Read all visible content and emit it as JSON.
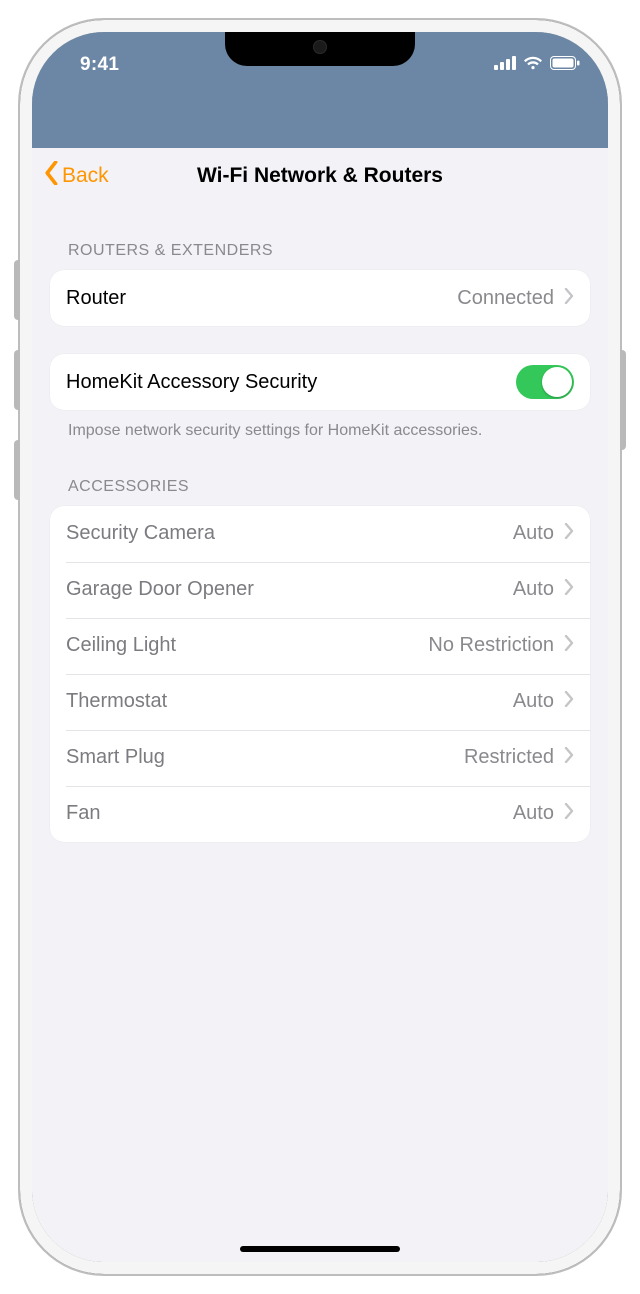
{
  "status": {
    "time": "9:41"
  },
  "nav": {
    "back_label": "Back",
    "title": "Wi-Fi Network & Routers"
  },
  "sections": {
    "routers_header": "ROUTERS & EXTENDERS",
    "router_row": {
      "label": "Router",
      "value": "Connected"
    },
    "security_toggle": {
      "label": "HomeKit Accessory Security",
      "on": true
    },
    "security_note": "Impose network security settings for HomeKit accessories.",
    "accessories_header": "ACCESSORIES",
    "accessories": [
      {
        "label": "Security Camera",
        "value": "Auto"
      },
      {
        "label": "Garage Door Opener",
        "value": "Auto"
      },
      {
        "label": "Ceiling Light",
        "value": "No Restriction"
      },
      {
        "label": "Thermostat",
        "value": "Auto"
      },
      {
        "label": "Smart Plug",
        "value": "Restricted"
      },
      {
        "label": "Fan",
        "value": "Auto"
      }
    ]
  }
}
